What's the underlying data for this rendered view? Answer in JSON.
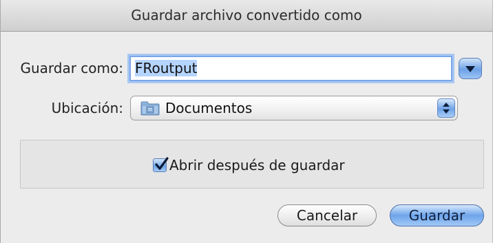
{
  "dialog": {
    "title": "Guardar archivo convertido como"
  },
  "save_as": {
    "label": "Guardar como:",
    "value": "FRoutput"
  },
  "location": {
    "label": "Ubicación:",
    "selected": "Documentos",
    "icon": "folder-icon"
  },
  "options": {
    "open_after_save_label": "Abrir después de guardar",
    "open_after_save_checked": true
  },
  "buttons": {
    "cancel": "Cancelar",
    "save": "Guardar"
  },
  "colors": {
    "accent": "#6ea4ea",
    "window_bg": "#ececec"
  }
}
